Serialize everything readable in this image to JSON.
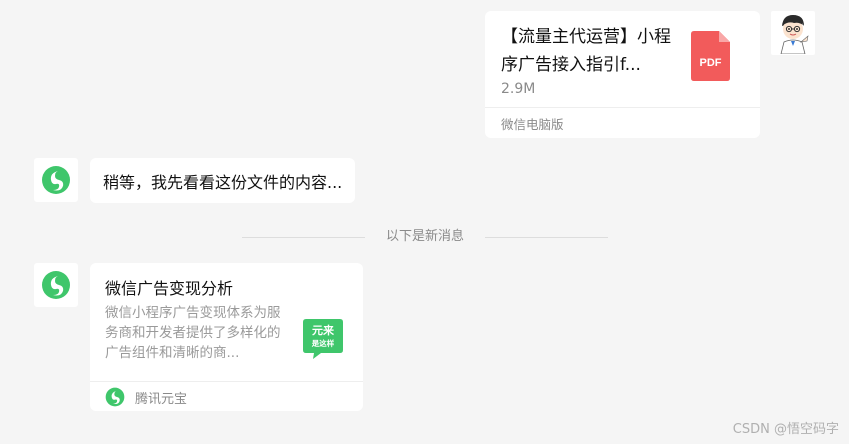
{
  "messages": {
    "file": {
      "title": "【流量主代运营】小程序广告接入指引f...",
      "size": "2.9M",
      "source": "微信电脑版",
      "icon_label": "PDF",
      "icon": "pdf-file-icon"
    },
    "bot_reply": {
      "text": "稍等，我先看看这份文件的内容..."
    },
    "divider": {
      "label": "以下是新消息"
    },
    "share": {
      "title": "微信广告变现分析",
      "description": "微信小程序广告变现体系为服务商和开发者提供了多样化的广告组件和清晰的商...",
      "thumb_line1": "元来",
      "thumb_line2": "是这样",
      "source": "腾讯元宝"
    }
  },
  "watermark": "CSDN @悟空码字",
  "colors": {
    "background": "#f5f5f5",
    "bubble": "#ffffff",
    "pdf_red": "#f25b5b",
    "brand_green": "#3fc66b"
  }
}
